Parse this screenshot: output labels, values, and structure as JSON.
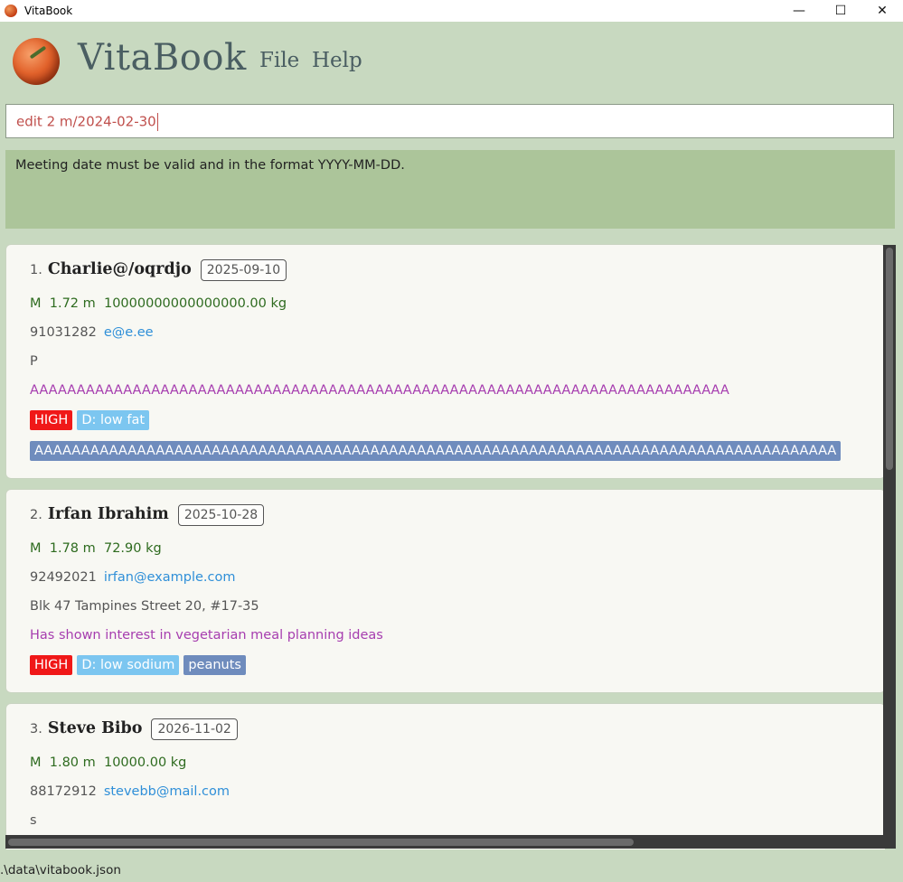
{
  "window": {
    "title": "VitaBook",
    "minimize_glyph": "—",
    "maximize_glyph": "☐",
    "close_glyph": "✕"
  },
  "header": {
    "brand": "VitaBook",
    "menu": [
      "File",
      "Help"
    ]
  },
  "command": {
    "value": "edit 2 m/2024-02-30"
  },
  "result": {
    "message": "Meeting date must be valid and in the format YYYY-MM-DD."
  },
  "colors": {
    "background": "#c8d9c0",
    "result_bg": "#acc59a",
    "priority_high": "#f01818",
    "diet_tag": "#7cc6f0",
    "allergy_tag": "#6f8cbd",
    "remark": "#a63daf",
    "email": "#2f8fd8"
  },
  "persons": [
    {
      "index": "1.",
      "name": "Charlie@/oqrdjo",
      "meeting": "2025-09-10",
      "gender": "M",
      "height": "1.72 m",
      "weight": "10000000000000000.00 kg",
      "phone": "91031282",
      "email": "e@e.ee",
      "address": "P",
      "remark": "AAAAAAAAAAAAAAAAAAAAAAAAAAAAAAAAAAAAAAAAAAAAAAAAAAAAAAAAAAAAAAAAAAAAAAAAAAA",
      "priority": "HIGH",
      "diet": "D: low fat",
      "allergy": "AAAAAAAAAAAAAAAAAAAAAAAAAAAAAAAAAAAAAAAAAAAAAAAAAAAAAAAAAAAAAAAAAAAAAAAAAAAAAAAAAAAAAA"
    },
    {
      "index": "2.",
      "name": "Irfan Ibrahim",
      "meeting": "2025-10-28",
      "gender": "M",
      "height": "1.78 m",
      "weight": "72.90 kg",
      "phone": "92492021",
      "email": "irfan@example.com",
      "address": "Blk 47 Tampines Street 20, #17-35",
      "remark": "Has shown interest in vegetarian meal planning ideas",
      "priority": "HIGH",
      "diet": "D: low sodium",
      "allergy": "peanuts"
    },
    {
      "index": "3.",
      "name": "Steve Bibo",
      "meeting": "2026-11-02",
      "gender": "M",
      "height": "1.80 m",
      "weight": "10000.00 kg",
      "phone": "88172912",
      "email": "stevebb@mail.com",
      "address": "s"
    }
  ],
  "status": {
    "file_path": ".\\data\\vitabook.json"
  }
}
